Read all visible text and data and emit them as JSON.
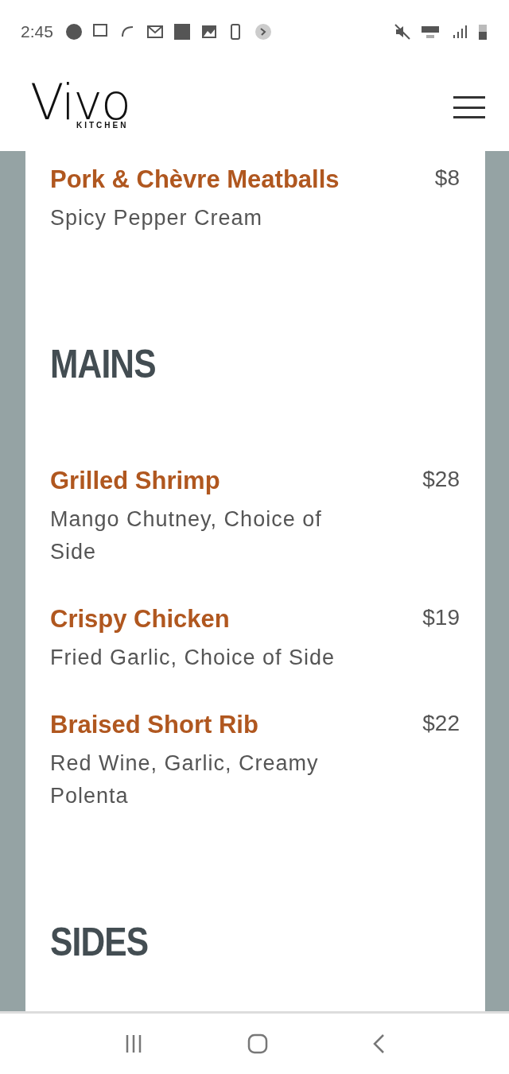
{
  "status_bar": {
    "time": "2:45"
  },
  "header": {
    "logo": {
      "word": "Vivo",
      "sub": "KITCHEN"
    }
  },
  "menu": [
    {
      "kind": "item",
      "name": "Pork & Chèvre Meatballs",
      "price": "$8",
      "description": "Spicy Pepper Cream"
    },
    {
      "kind": "heading",
      "title": "MAINS"
    },
    {
      "kind": "item",
      "name": "Grilled Shrimp",
      "price": "$28",
      "description": "Mango Chutney, Choice of Side"
    },
    {
      "kind": "item",
      "name": "Crispy Chicken",
      "price": "$19",
      "description": "Fried Garlic, Choice of Side"
    },
    {
      "kind": "item",
      "name": "Braised Short Rib",
      "price": "$22",
      "description": "Red Wine, Garlic, Creamy Polenta"
    },
    {
      "kind": "heading",
      "title": "SIDES"
    }
  ]
}
